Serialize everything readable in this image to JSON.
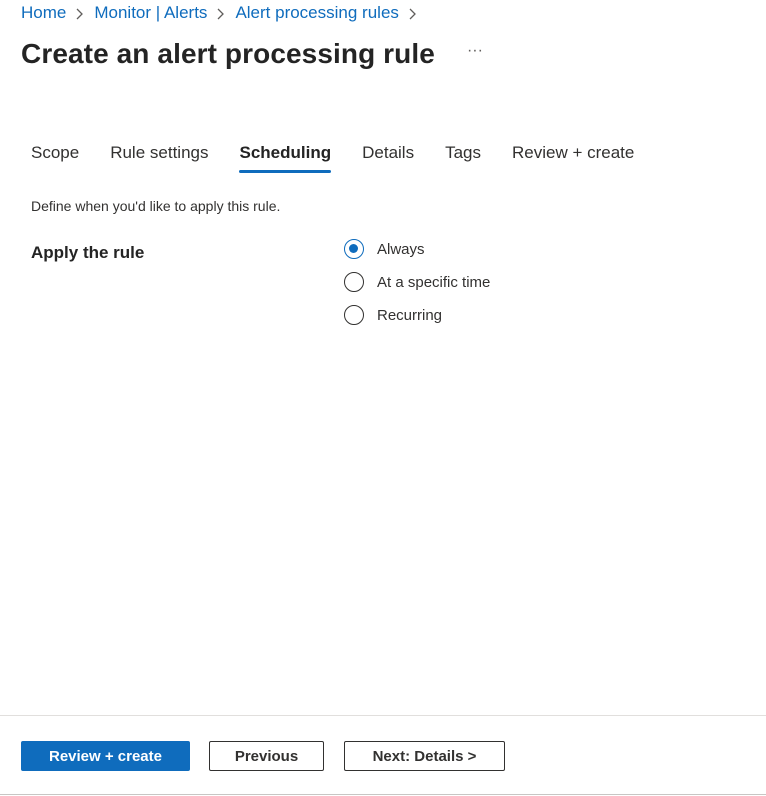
{
  "breadcrumb": {
    "items": [
      "Home",
      "Monitor | Alerts",
      "Alert processing rules"
    ]
  },
  "page": {
    "title": "Create an alert processing rule",
    "more_label": "···"
  },
  "tabs": [
    {
      "label": "Scope",
      "active": false
    },
    {
      "label": "Rule settings",
      "active": false
    },
    {
      "label": "Scheduling",
      "active": true
    },
    {
      "label": "Details",
      "active": false
    },
    {
      "label": "Tags",
      "active": false
    },
    {
      "label": "Review + create",
      "active": false
    }
  ],
  "scheduling": {
    "description": "Define when you'd like to apply this rule.",
    "apply_label": "Apply the rule",
    "options": [
      {
        "label": "Always",
        "selected": true
      },
      {
        "label": "At a specific time",
        "selected": false
      },
      {
        "label": "Recurring",
        "selected": false
      }
    ]
  },
  "footer": {
    "review_create_label": "Review + create",
    "previous_label": "Previous",
    "next_label": "Next: Details >"
  },
  "colors": {
    "accent": "#0f6cbd",
    "text": "#323130",
    "divider": "#e1dfdd"
  }
}
